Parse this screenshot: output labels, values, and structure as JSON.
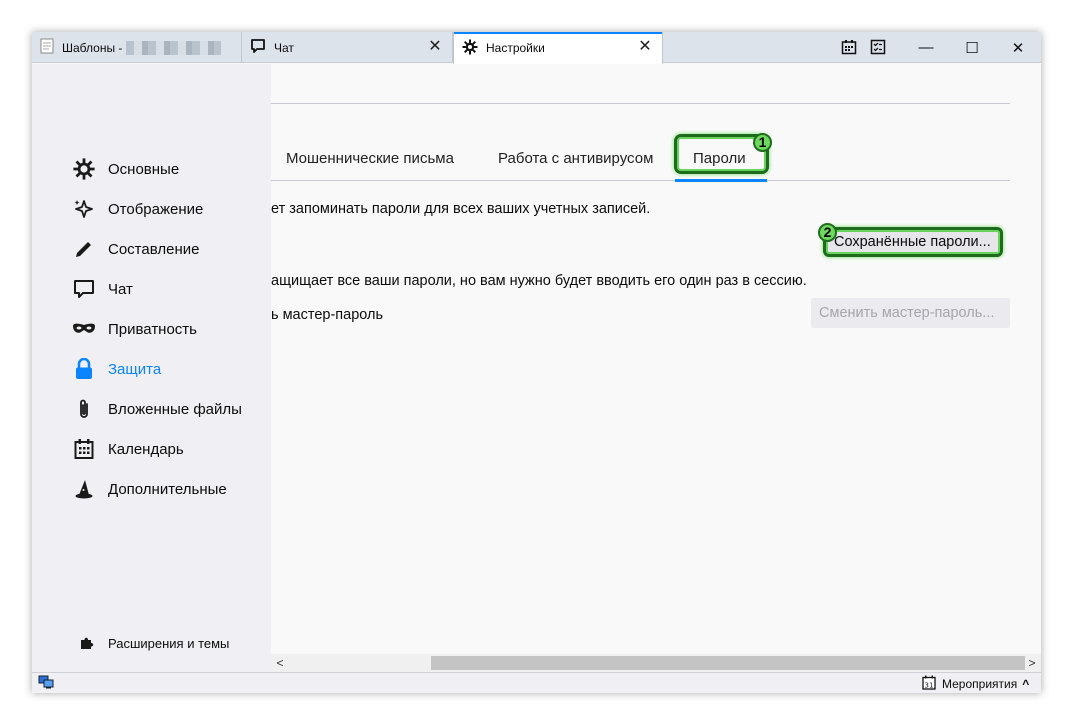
{
  "tabs": [
    {
      "label": "Шаблоны -",
      "icon": "document-icon"
    },
    {
      "label": "Чат",
      "icon": "chat-icon"
    },
    {
      "label": "Настройки",
      "icon": "gear-icon"
    }
  ],
  "window_controls": {
    "minimize": "—",
    "maximize": "☐",
    "close": "✕"
  },
  "sidebar": {
    "items": [
      {
        "label": "Основные",
        "icon": "gear-icon"
      },
      {
        "label": "Отображение",
        "icon": "sparkle-icon"
      },
      {
        "label": "Составление",
        "icon": "pencil-icon"
      },
      {
        "label": "Чат",
        "icon": "chat-icon"
      },
      {
        "label": "Приватность",
        "icon": "mask-icon"
      },
      {
        "label": "Защита",
        "icon": "lock-icon",
        "selected": true
      },
      {
        "label": "Вложенные файлы",
        "icon": "paperclip-icon"
      },
      {
        "label": "Календарь",
        "icon": "calendar-icon"
      },
      {
        "label": "Дополнительные",
        "icon": "wizard-hat-icon"
      }
    ],
    "extensions": {
      "label": "Расширения и темы",
      "icon": "puzzle-icon"
    }
  },
  "subtabs": [
    {
      "label": "Мошеннические письма"
    },
    {
      "label": "Работа с антивирусом"
    },
    {
      "label": "Пароли",
      "selected": true
    }
  ],
  "passwords": {
    "remember_text": "ет запоминать пароли для всех ваших учетных записей.",
    "saved_button": "Сохранённые пароли...",
    "master_text": "ащищает все ваши пароли, но вам нужно будет вводить его один раз в сессию.",
    "use_master_label": "ь мастер-пароль",
    "change_master_button": "Сменить мастер-пароль..."
  },
  "annotations": {
    "badge_1": "1",
    "badge_2": "2"
  },
  "scrollbar": {
    "left_arrow": "<",
    "right_arrow": ">"
  },
  "statusbar": {
    "events_label": "Мероприятия",
    "events_icon": "calendar-31-icon",
    "chevron": "^"
  },
  "colors": {
    "accent": "#0a84ff",
    "highlight_green": "#6fd95e",
    "highlight_dark": "#1d6b1d"
  }
}
